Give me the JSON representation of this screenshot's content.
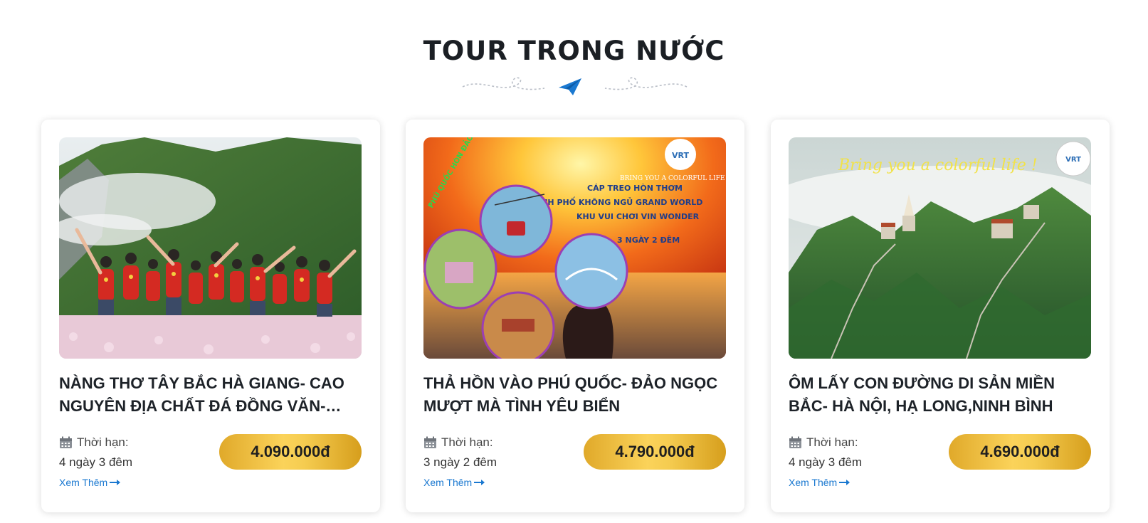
{
  "section": {
    "title": "TOUR TRONG NƯỚC",
    "divider_icon": "paper-plane-icon",
    "accent_color": "#1a78d0",
    "price_gradient": [
      "#e0a92a",
      "#fbd35a",
      "#d69e1c"
    ]
  },
  "tours": [
    {
      "title": "NÀNG THƠ TÂY BẮC HÀ GIANG- CAO NGUYÊN ĐỊA CHẤT ĐÁ ĐỒNG VĂN- HOA TAM GIÁC MẠCH",
      "image": "group-photo-flower-field",
      "duration_label": "Thời hạn:",
      "duration": "4 ngày 3 đêm",
      "more_label": "Xem Thêm",
      "price": "4.090.000đ"
    },
    {
      "title": "THẢ HỒN VÀO PHÚ QUỐC- ĐẢO NGỌC MƯỢT MÀ TÌNH YÊU BIỂN",
      "image": "phu-quoc-poster",
      "poster_lines": [
        "BRING YOU A COLORFUL LIFE",
        "CÁP TREO HÒN THƠM",
        "THÀNH PHỐ KHÔNG NGỦ GRAND WORLD",
        "KHU VUI CHƠI VIN WONDER",
        "3 NGÀY 2 ĐÊM"
      ],
      "duration_label": "Thời hạn:",
      "duration": "3 ngày 2 đêm",
      "more_label": "Xem Thêm",
      "price": "4.790.000đ"
    },
    {
      "title": "ÔM LẤY CON ĐƯỜNG DI SẢN MIỀN BẮC- HÀ NỘI, HẠ LONG,NINH BÌNH",
      "image": "mountain-temple-aerial",
      "poster_lines": [
        "Bring you a colorful life !"
      ],
      "duration_label": "Thời hạn:",
      "duration": "4 ngày 3 đêm",
      "more_label": "Xem Thêm",
      "price": "4.690.000đ"
    }
  ]
}
